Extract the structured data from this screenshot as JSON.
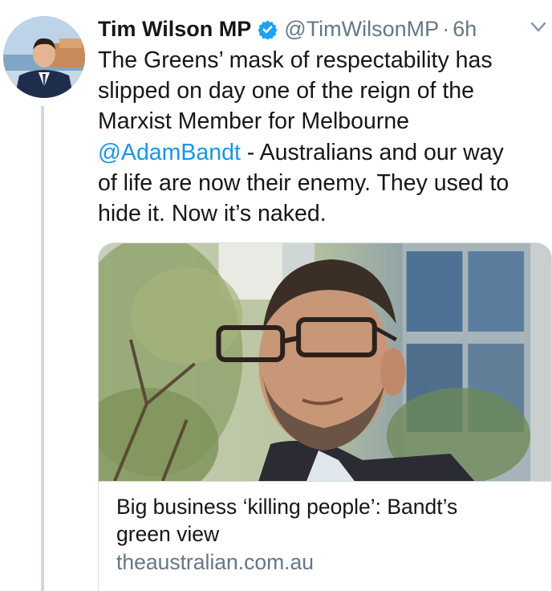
{
  "tweet": {
    "author_name": "Tim Wilson MP",
    "handle": "@TimWilsonMP",
    "separator": "·",
    "time": "6h",
    "verified_icon": "verified-badge-icon",
    "menu_icon": "chevron-down-icon",
    "text_line1": "The Greens’ mask of respectability has",
    "text_line2": "slipped on day one of the reign of the",
    "text_line3": "Marxist Member for Melbourne",
    "mention": "@AdamBandt",
    "text_after_mention": " - Australians and our way",
    "text_line5": "of life are now their enemy. They used to",
    "text_line6": "hide it. Now it’s naked."
  },
  "card": {
    "title_line1": "Big business ‘killing people’: Bandt’s",
    "title_line2": "green view",
    "domain": "theaustralian.com.au"
  },
  "colors": {
    "link": "#1b95e0",
    "secondary_text": "#657786",
    "primary_text": "#14171a",
    "border": "#d5dde3",
    "verified": "#1da1f2"
  }
}
